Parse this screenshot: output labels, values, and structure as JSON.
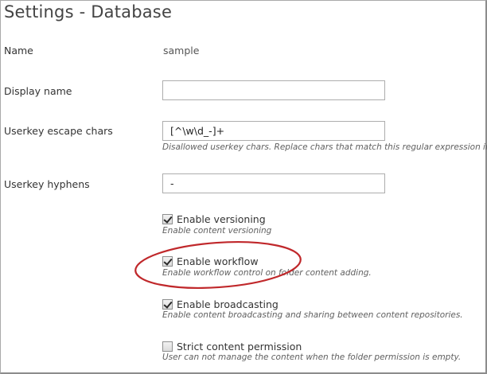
{
  "page": {
    "title": "Settings - Database"
  },
  "fields": {
    "name": {
      "label": "Name",
      "value": "sample"
    },
    "display_name": {
      "label": "Display name",
      "value": ""
    },
    "userkey_escape": {
      "label": "Userkey escape chars",
      "value": "[^\\w\\d_-]+",
      "hint": "Disallowed userkey chars. Replace chars that match this regular expression into"
    },
    "userkey_hyphens": {
      "label": "Userkey hyphens",
      "value": "-"
    }
  },
  "options": {
    "versioning": {
      "label": "Enable versioning",
      "hint": "Enable content versioning",
      "checked": true
    },
    "workflow": {
      "label": "Enable workflow",
      "hint": "Enable workflow control on folder content adding.",
      "checked": true
    },
    "broadcasting": {
      "label": "Enable broadcasting",
      "hint": "Enable content broadcasting and sharing between content repositories.",
      "checked": true
    },
    "strict_permission": {
      "label": "Strict content permission",
      "hint": "User can not manage the content when the folder permission is empty.",
      "checked": false
    }
  },
  "annotation": {
    "color": "#c0282b"
  }
}
